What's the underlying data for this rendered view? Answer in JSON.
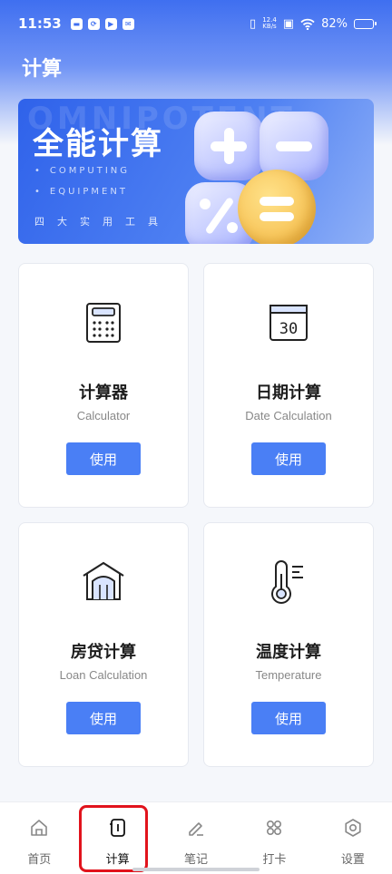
{
  "status_bar": {
    "time": "11:53",
    "net_speed_value": "12.4",
    "net_speed_unit": "KB/s",
    "battery": "82%",
    "battery_level": 0.82
  },
  "header": {
    "title": "计算"
  },
  "banner": {
    "title": "全能计算",
    "watermark": "OMNIPOTENT",
    "sub1": "COMPUTING",
    "sub2": "EQUIPMENT",
    "tools": "四大实用工具"
  },
  "cards": [
    {
      "title": "计算器",
      "subtitle": "Calculator",
      "button": "使用"
    },
    {
      "title": "日期计算",
      "subtitle": "Date Calculation",
      "button": "使用",
      "icon_text": "30"
    },
    {
      "title": "房贷计算",
      "subtitle": "Loan Calculation",
      "button": "使用"
    },
    {
      "title": "温度计算",
      "subtitle": "Temperature",
      "button": "使用"
    }
  ],
  "tabbar": [
    {
      "label": "首页",
      "icon": "home-icon"
    },
    {
      "label": "计算",
      "icon": "calculator-tab-icon",
      "active": true
    },
    {
      "label": "笔记",
      "icon": "pen-icon"
    },
    {
      "label": "打卡",
      "icon": "grid-icon"
    },
    {
      "label": "设置",
      "icon": "settings-icon"
    }
  ],
  "colors": {
    "primary": "#4a7ff5",
    "header_gradient_top": "#3f6ff0",
    "highlight": "#e1131c"
  }
}
